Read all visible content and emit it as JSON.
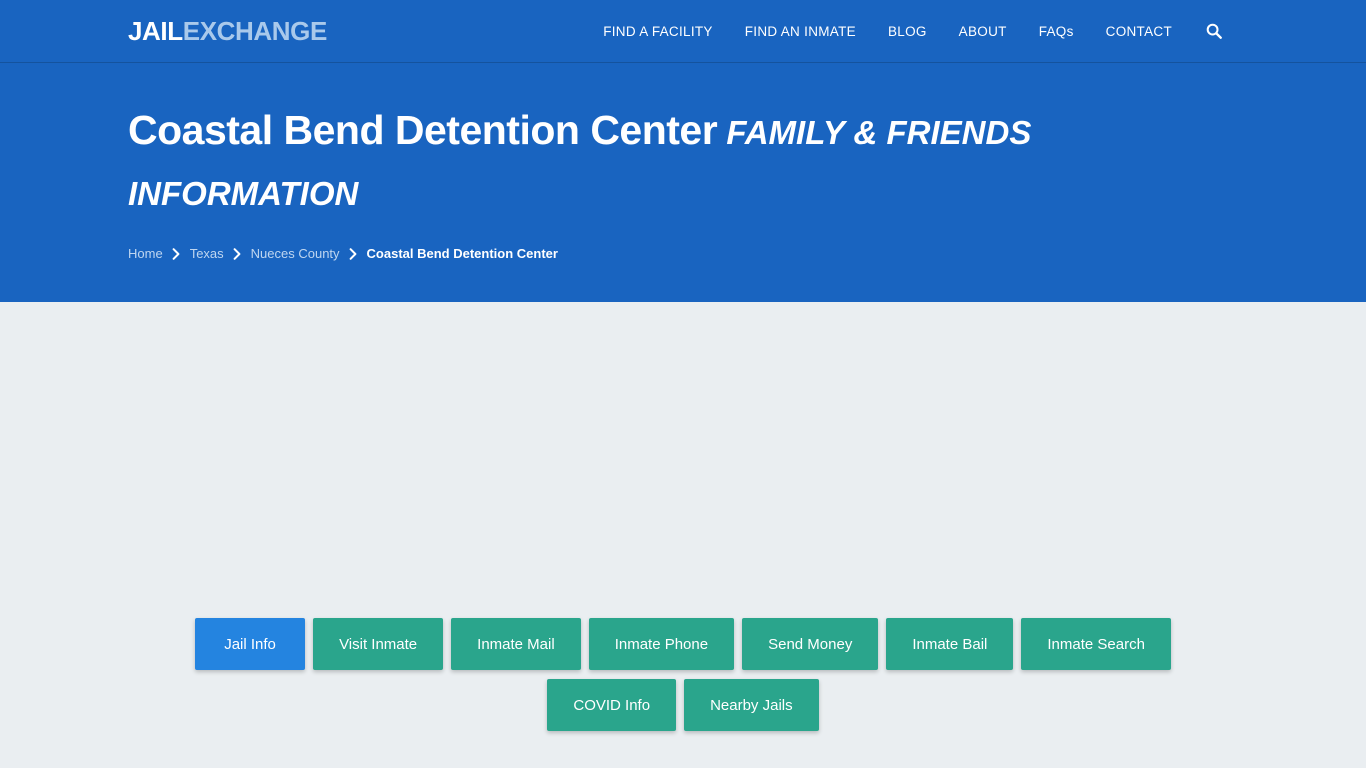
{
  "header": {
    "logo": {
      "part1": "JAIL",
      "part2": "EXCHANGE",
      "name": "Jail Exchange"
    },
    "nav_items": [
      {
        "label": "FIND A FACILITY",
        "name": "nav-link-find-a-facility"
      },
      {
        "label": "FIND AN INMATE",
        "name": "nav-link-find-an-inmate"
      },
      {
        "label": "BLOG",
        "name": "nav-link-blog"
      },
      {
        "label": "ABOUT",
        "name": "nav-link-about"
      },
      {
        "label": "FAQs",
        "name": "nav-link-faqs"
      },
      {
        "label": "CONTACT",
        "name": "nav-link-contact"
      }
    ],
    "search_icon": "search-icon"
  },
  "hero": {
    "title_main": "Coastal Bend Detention Center",
    "title_sub": "FAMILY & FRIENDS INFORMATION",
    "breadcrumb": {
      "items": [
        {
          "label": "Home",
          "current": false
        },
        {
          "label": "Texas",
          "current": false
        },
        {
          "label": "Nueces County",
          "current": false
        },
        {
          "label": "Coastal Bend Detention Center",
          "current": true
        }
      ],
      "separator_icon": "chevron-right-icon"
    }
  },
  "main": {
    "tab_rows": [
      [
        {
          "label": "Jail Info",
          "active": true
        },
        {
          "label": "Visit Inmate",
          "active": false
        },
        {
          "label": "Inmate Mail",
          "active": false
        },
        {
          "label": "Inmate Phone",
          "active": false
        },
        {
          "label": "Send Money",
          "active": false
        },
        {
          "label": "Inmate Bail",
          "active": false
        },
        {
          "label": "Inmate Search",
          "active": false
        }
      ],
      [
        {
          "label": "COVID Info",
          "active": false
        },
        {
          "label": "Nearby Jails",
          "active": false
        }
      ]
    ]
  },
  "colors": {
    "brand_blue": "#1964C0",
    "active_blue": "#2484E0",
    "teal": "#2AA58C",
    "page_bg": "#EAEEF1",
    "logo_accent": "#A9C9EB",
    "breadcrumb_link": "#BFD6F0"
  }
}
